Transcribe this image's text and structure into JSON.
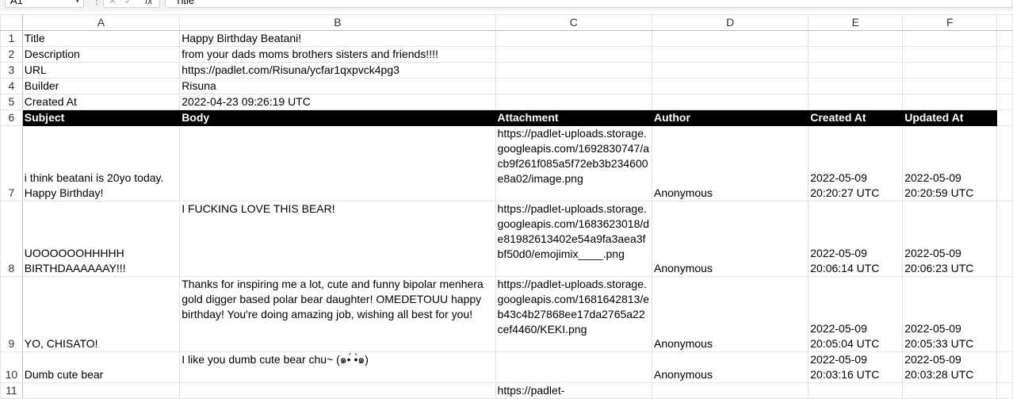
{
  "formula_bar": {
    "name_box": "A1",
    "formula": "Title",
    "fx_label": "fx"
  },
  "columns": [
    "A",
    "B",
    "C",
    "D",
    "E",
    "F"
  ],
  "meta_rows": [
    {
      "row": "1",
      "label": "Title",
      "value": "Happy Birthday Beatani!"
    },
    {
      "row": "2",
      "label": "Description",
      "value": "from your dads moms brothers sisters and friends!!!!"
    },
    {
      "row": "3",
      "label": "URL",
      "value": "https://padlet.com/Risuna/ycfar1qxpvck4pg3"
    },
    {
      "row": "4",
      "label": "Builder",
      "value": "Risuna"
    },
    {
      "row": "5",
      "label": "Created At",
      "value": "2022-04-23 09:26:19 UTC"
    }
  ],
  "header_row": {
    "row": "6",
    "cells": [
      "Subject",
      "Body",
      "Attachment",
      "Author",
      "Created At",
      "Updated At"
    ]
  },
  "posts": [
    {
      "row": "7",
      "subject": "i think beatani is 20yo today. Happy Birthday!",
      "body": "",
      "attachment": "https://padlet-uploads.storage.googleapis.com/1692830747/acb9f261f085a5f72eb3b234600e8a02/image.png",
      "author": "Anonymous",
      "created": "2022-05-09 20:20:27 UTC",
      "updated": "2022-05-09 20:20:59 UTC"
    },
    {
      "row": "8",
      "subject": "UOOOOOOHHHHH BIRTHDAAAAAAY!!!",
      "body": "I FUCKING LOVE THIS BEAR!",
      "attachment": "https://padlet-uploads.storage.googleapis.com/1683623018/de81982613402e54a9fa3aea3fbf50d0/emojimix____.png",
      "author": "Anonymous",
      "created": "2022-05-09 20:06:14 UTC",
      "updated": "2022-05-09 20:06:23 UTC"
    },
    {
      "row": "9",
      "subject": "YO, CHISATO!",
      "body": "Thanks for inspiring me a lot, cute and funny bipolar menhera gold digger based polar bear daughter! OMEDETOUU happy birthday! You're doing amazing job, wishing all best for you!",
      "attachment": "https://padlet-uploads.storage.googleapis.com/1681642813/eb43c4b27868ee17da2765a22cef4460/KEKI.png",
      "author": "Anonymous",
      "created": "2022-05-09 20:05:04 UTC",
      "updated": "2022-05-09 20:05:33 UTC"
    },
    {
      "row": "10",
      "subject": "Dumb cute bear",
      "body": "I like you dumb cute bear chu~ (๑•́  •̀๑)",
      "attachment": "",
      "author": "Anonymous",
      "created": "2022-05-09 20:03:16 UTC",
      "updated": "2022-05-09 20:03:28 UTC"
    }
  ],
  "partial_row": {
    "row": "11",
    "attachment": "https://padlet-"
  }
}
